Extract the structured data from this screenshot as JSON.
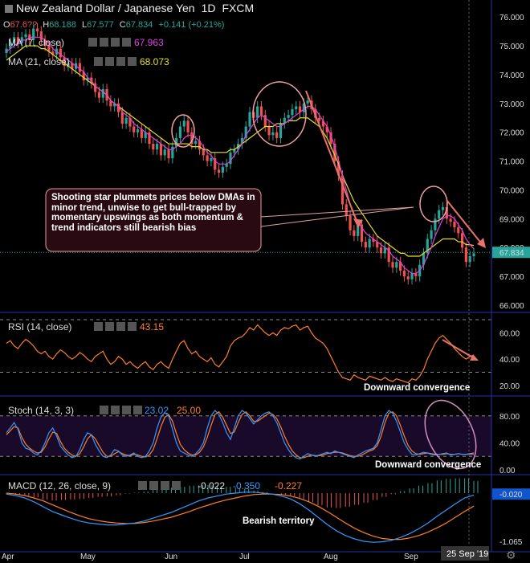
{
  "header": {
    "title": "New Zealand Dollar / Japanese Yen",
    "interval": "1D",
    "source": "FXCM",
    "ohlc": {
      "o_label": "O",
      "o_value": "67.6??",
      "h_label": "H",
      "h_value": "68.188",
      "l_label": "L",
      "l_value": "67.577",
      "c_label": "C",
      "c_value": "67.834",
      "change": "+0.141 (+0.21%)"
    }
  },
  "indicators": {
    "ma7": {
      "label": "MA (7, close)",
      "value": "67.963",
      "color": "#e040e0"
    },
    "ma21": {
      "label": "MA (21, close)",
      "value": "68.073",
      "color": "#e8e020"
    },
    "rsi": {
      "label": "RSI (14, close)",
      "value": "43.15",
      "color": "#ff7f27"
    },
    "stoch": {
      "label": "Stoch (14, 3, 3)",
      "k_value": "23.02",
      "d_value": "25.00",
      "k_color": "#3399ff",
      "d_color": "#ff7f27"
    },
    "macd": {
      "label": "MACD (12, 26, close, 9)",
      "v1": "-0.022",
      "v2": "-0.350",
      "v3": "-0.227"
    }
  },
  "annotations": {
    "main_box": "Shooting star plummets prices below DMAs in minor trend, unwise to get bull-trapped by momentary upswings as both momentum & trend indicators still bearish bias",
    "rsi_note": "Downward convergence",
    "stoch_note": "Downward convergence",
    "macd_note": "Bearish territory"
  },
  "axes": {
    "price_ticks": [
      "76.000",
      "75.000",
      "74.000",
      "73.000",
      "72.000",
      "71.000",
      "70.000",
      "69.000",
      "68.000",
      "67.000",
      "66.000"
    ],
    "rsi_ticks": [
      "60.00",
      "40.00",
      "20.00"
    ],
    "stoch_ticks": [
      "80.00",
      "40.00",
      "0.00"
    ],
    "macd_ticks": [
      "-0.020",
      "-1.065"
    ],
    "months": [
      "Apr",
      "May",
      "Jun",
      "Jul",
      "Aug",
      "Sep"
    ],
    "date_label": "25 Sep '19"
  },
  "colors": {
    "up": "#26a69a",
    "down": "#ef5350",
    "arrow": "#e8736a",
    "grid": "#222"
  },
  "chart_data": {
    "type": "candlestick",
    "title": "New Zealand Dollar / Japanese Yen 1D FXCM",
    "ylim": [
      66.0,
      76.2
    ],
    "closes": [
      74.9,
      75.1,
      75.3,
      75.1,
      75.3,
      75.4,
      75.2,
      75.6,
      75.5,
      75.2,
      75.0,
      74.8,
      74.7,
      74.9,
      74.6,
      74.3,
      74.4,
      74.2,
      74.4,
      74.1,
      73.8,
      73.9,
      73.7,
      73.4,
      73.2,
      73.5,
      73.1,
      72.9,
      73.0,
      72.7,
      72.3,
      72.5,
      72.2,
      72.0,
      72.1,
      71.8,
      72.0,
      71.6,
      71.4,
      71.6,
      71.2,
      71.4,
      71.1,
      71.5,
      71.8,
      72.2,
      72.4,
      72.0,
      71.6,
      71.7,
      71.4,
      71.2,
      71.0,
      71.1,
      70.7,
      70.6,
      70.8,
      70.9,
      71.3,
      71.4,
      71.6,
      71.8,
      72.2,
      72.7,
      72.5,
      72.9,
      72.6,
      72.2,
      71.9,
      72.0,
      71.8,
      72.3,
      72.5,
      72.6,
      72.8,
      72.9,
      72.7,
      73.0,
      73.1,
      72.8,
      72.5,
      72.4,
      72.2,
      72.0,
      71.6,
      71.0,
      70.5,
      69.5,
      69.1,
      68.6,
      68.4,
      68.8,
      68.2,
      68.0,
      68.3,
      68.2,
      68.0,
      67.8,
      68.0,
      67.5,
      67.3,
      67.5,
      67.2,
      67.0,
      66.9,
      67.1,
      67.0,
      67.4,
      67.8,
      68.3,
      68.6,
      69.0,
      69.3,
      69.4,
      69.0,
      68.9,
      68.7,
      68.5,
      68.0,
      67.5,
      67.7,
      67.8
    ],
    "ma7": [
      74.8,
      74.9,
      75.0,
      75.1,
      75.2,
      75.2,
      75.3,
      75.3,
      75.3,
      75.3,
      75.2,
      75.1,
      74.9,
      74.8,
      74.7,
      74.6,
      74.5,
      74.4,
      74.3,
      74.2,
      74.1,
      73.9,
      73.8,
      73.6,
      73.5,
      73.4,
      73.3,
      73.1,
      73.0,
      72.9,
      72.7,
      72.6,
      72.5,
      72.3,
      72.2,
      72.1,
      72.0,
      71.9,
      71.8,
      71.7,
      71.6,
      71.5,
      71.4,
      71.4,
      71.5,
      71.6,
      71.8,
      71.9,
      71.9,
      71.8,
      71.7,
      71.5,
      71.3,
      71.2,
      71.0,
      70.9,
      70.9,
      70.9,
      71.0,
      71.2,
      71.4,
      71.6,
      71.9,
      72.1,
      72.3,
      72.5,
      72.6,
      72.5,
      72.4,
      72.3,
      72.2,
      72.2,
      72.3,
      72.4,
      72.5,
      72.6,
      72.7,
      72.8,
      72.9,
      72.9,
      72.8,
      72.6,
      72.4,
      72.2,
      71.9,
      71.5,
      71.0,
      70.5,
      70.0,
      69.5,
      69.1,
      68.9,
      68.7,
      68.5,
      68.4,
      68.3,
      68.2,
      68.1,
      68.0,
      67.9,
      67.7,
      67.6,
      67.5,
      67.3,
      67.2,
      67.1,
      67.1,
      67.2,
      67.4,
      67.7,
      68.0,
      68.4,
      68.7,
      69.0,
      69.1,
      69.1,
      69.0,
      68.8,
      68.6,
      68.3,
      68.1,
      67.96
    ],
    "ma21": [
      74.5,
      74.6,
      74.7,
      74.8,
      74.9,
      75.0,
      75.0,
      75.0,
      75.0,
      74.9,
      74.9,
      74.8,
      74.7,
      74.6,
      74.5,
      74.4,
      74.3,
      74.2,
      74.1,
      74.0,
      73.9,
      73.8,
      73.7,
      73.6,
      73.5,
      73.4,
      73.3,
      73.1,
      73.0,
      72.9,
      72.8,
      72.7,
      72.6,
      72.5,
      72.4,
      72.3,
      72.2,
      72.1,
      72.0,
      71.9,
      71.8,
      71.7,
      71.6,
      71.6,
      71.6,
      71.6,
      71.6,
      71.6,
      71.5,
      71.5,
      71.5,
      71.4,
      71.4,
      71.3,
      71.3,
      71.3,
      71.3,
      71.3,
      71.4,
      71.4,
      71.5,
      71.6,
      71.7,
      71.8,
      71.9,
      72.0,
      72.1,
      72.2,
      72.2,
      72.2,
      72.3,
      72.3,
      72.3,
      72.4,
      72.4,
      72.4,
      72.5,
      72.5,
      72.5,
      72.4,
      72.3,
      72.2,
      72.0,
      71.8,
      71.5,
      71.2,
      70.9,
      70.5,
      70.2,
      69.9,
      69.6,
      69.4,
      69.2,
      69.0,
      68.8,
      68.6,
      68.4,
      68.3,
      68.2,
      68.1,
      68.0,
      67.9,
      67.8,
      67.8,
      67.7,
      67.7,
      67.7,
      67.7,
      67.8,
      67.9,
      68.0,
      68.1,
      68.2,
      68.3,
      68.3,
      68.3,
      68.3,
      68.2,
      68.2,
      68.1,
      68.1,
      68.07
    ],
    "rsi": [
      52,
      54,
      50,
      48,
      52,
      55,
      53,
      50,
      46,
      44,
      46,
      42,
      40,
      44,
      47,
      45,
      42,
      40,
      42,
      45,
      43,
      40,
      38,
      42,
      44,
      46,
      40,
      36,
      38,
      42,
      40,
      36,
      38,
      35,
      33,
      36,
      38,
      34,
      32,
      36,
      38,
      35,
      33,
      40,
      46,
      52,
      54,
      48,
      44,
      46,
      42,
      40,
      38,
      41,
      36,
      34,
      38,
      42,
      50,
      54,
      56,
      57,
      60,
      64,
      62,
      66,
      63,
      60,
      58,
      60,
      58,
      62,
      64,
      63,
      65,
      66,
      62,
      64,
      65,
      60,
      56,
      54,
      52,
      48,
      42,
      36,
      30,
      26,
      25,
      24,
      28,
      26,
      25,
      24,
      27,
      26,
      25,
      24,
      26,
      24,
      23,
      25,
      24,
      23,
      22,
      25,
      24,
      27,
      32,
      40,
      46,
      52,
      56,
      58,
      55,
      52,
      48,
      45,
      42,
      40,
      42,
      43
    ],
    "stoch_k": [
      55,
      62,
      70,
      60,
      40,
      32,
      30,
      25,
      22,
      28,
      40,
      55,
      62,
      50,
      35,
      28,
      22,
      18,
      20,
      30,
      45,
      55,
      52,
      38,
      28,
      20,
      18,
      22,
      30,
      28,
      22,
      20,
      22,
      25,
      20,
      18,
      20,
      28,
      40,
      62,
      78,
      85,
      80,
      60,
      40,
      28,
      25,
      22,
      20,
      24,
      30,
      40,
      62,
      80,
      88,
      82,
      70,
      55,
      45,
      62,
      80,
      88,
      84,
      76,
      68,
      74,
      80,
      84,
      86,
      80,
      70,
      55,
      40,
      30,
      22,
      18,
      16,
      20,
      24,
      22,
      20,
      22,
      24,
      26,
      24,
      28,
      26,
      24,
      22,
      20,
      18,
      22,
      25,
      28,
      30,
      32,
      40,
      60,
      80,
      88,
      84,
      72,
      56,
      40,
      30,
      23,
      22,
      24,
      26,
      25,
      23,
      22,
      23,
      24,
      25,
      22,
      23,
      24,
      23,
      23,
      23,
      23
    ],
    "stoch_d": [
      52,
      58,
      64,
      62,
      48,
      38,
      32,
      28,
      25,
      26,
      34,
      46,
      56,
      54,
      42,
      32,
      26,
      22,
      20,
      24,
      34,
      46,
      52,
      46,
      36,
      26,
      20,
      20,
      24,
      27,
      24,
      22,
      21,
      23,
      22,
      20,
      19,
      22,
      30,
      46,
      64,
      78,
      82,
      72,
      54,
      38,
      30,
      25,
      22,
      22,
      26,
      34,
      48,
      66,
      82,
      86,
      78,
      66,
      54,
      56,
      70,
      82,
      86,
      80,
      72,
      72,
      76,
      80,
      84,
      82,
      76,
      64,
      50,
      38,
      28,
      22,
      18,
      18,
      20,
      22,
      21,
      21,
      22,
      24,
      25,
      26,
      26,
      25,
      23,
      21,
      20,
      20,
      22,
      25,
      28,
      30,
      36,
      50,
      70,
      84,
      86,
      80,
      66,
      50,
      36,
      28,
      24,
      23,
      24,
      25,
      24,
      23,
      23,
      23,
      24,
      23,
      23,
      24,
      23,
      23,
      24,
      25
    ],
    "macd": [
      -0.02,
      -0.05,
      -0.1,
      -0.18,
      -0.28,
      -0.38,
      -0.45,
      -0.52,
      -0.58,
      -0.62,
      -0.64,
      -0.66,
      -0.66,
      -0.64,
      -0.62,
      -0.58,
      -0.52,
      -0.46,
      -0.4,
      -0.32,
      -0.24,
      -0.16,
      -0.1,
      -0.06,
      -0.02,
      0.0,
      0.02,
      0.02,
      0.0,
      -0.02,
      -0.06,
      -0.12,
      -0.22,
      -0.35,
      -0.5,
      -0.65,
      -0.78,
      -0.88,
      -0.95,
      -1.0,
      -1.02,
      -1.01,
      -0.98,
      -0.92,
      -0.84,
      -0.74,
      -0.62,
      -0.48,
      -0.35,
      -0.22,
      -0.1,
      -0.04
    ],
    "macd_signal": [
      0.0,
      -0.02,
      -0.05,
      -0.1,
      -0.16,
      -0.24,
      -0.32,
      -0.4,
      -0.47,
      -0.53,
      -0.57,
      -0.6,
      -0.62,
      -0.63,
      -0.63,
      -0.61,
      -0.58,
      -0.54,
      -0.5,
      -0.44,
      -0.38,
      -0.31,
      -0.25,
      -0.19,
      -0.14,
      -0.1,
      -0.06,
      -0.03,
      -0.02,
      -0.02,
      -0.03,
      -0.06,
      -0.11,
      -0.18,
      -0.27,
      -0.38,
      -0.5,
      -0.62,
      -0.73,
      -0.82,
      -0.89,
      -0.94,
      -0.96,
      -0.96,
      -0.93,
      -0.88,
      -0.81,
      -0.72,
      -0.62,
      -0.5,
      -0.38,
      -0.27
    ]
  }
}
